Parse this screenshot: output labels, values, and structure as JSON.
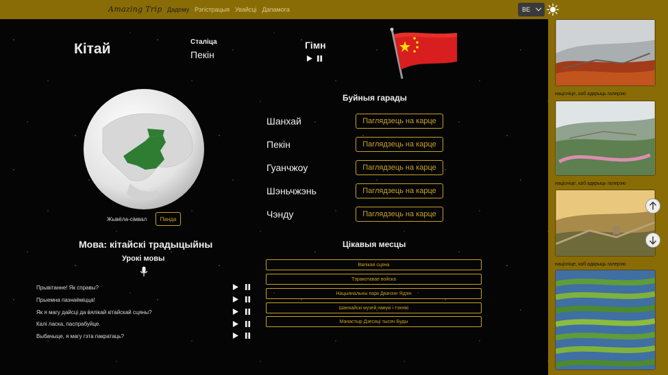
{
  "header": {
    "logo": "Amazing Trip",
    "nav": [
      "Дадому",
      "Рэгістрацыя",
      "Увайсці",
      "Дапамога"
    ],
    "language": "BE",
    "colors": {
      "header_bg": "#8a6c06",
      "accent": "#c9a227"
    }
  },
  "country": {
    "name": "Кітай",
    "capital_label": "Сталіца",
    "capital": "Пекін",
    "anthem_label": "Гімн",
    "animal_label": "Жывёла-сімвал",
    "animal": "Панда"
  },
  "cities": {
    "title": "Буйныя гарады",
    "items": [
      {
        "name": "Шанхай",
        "button": "Паглядзець на карце"
      },
      {
        "name": "Пекін",
        "button": "Паглядзець на карце"
      },
      {
        "name": "Гуанчжоу",
        "button": "Паглядзець на карце"
      },
      {
        "name": "Шэньчжэнь",
        "button": "Паглядзець на карце"
      },
      {
        "name": "Чэнду",
        "button": "Паглядзець на карце"
      }
    ]
  },
  "language": {
    "title": "Мова: кітайскі традыцыйны",
    "lessons_title": "Урокі мовы",
    "phrases": [
      "Прывітанне! Як справы?",
      "Прыемна пазнаёміцца!",
      "Як я магу дайсці да вялікай кітайскай сцяны?",
      "Калі ласка, паспрабуйце.",
      "Выбачыце, я магу гэта пакратаць?"
    ]
  },
  "places": {
    "title": "Цікавыя месцы",
    "items": [
      "Вялікая сцяна",
      "Тэракотавае войска",
      "Нацыянальны парк Двачэнг Ядзін",
      "Шанхайскі музей навукі і тэхнікі",
      "Манастыр Дзесяці тысяч Буды"
    ]
  },
  "gallery": {
    "caption": "націсніце, каб адкрыць галерэю"
  }
}
